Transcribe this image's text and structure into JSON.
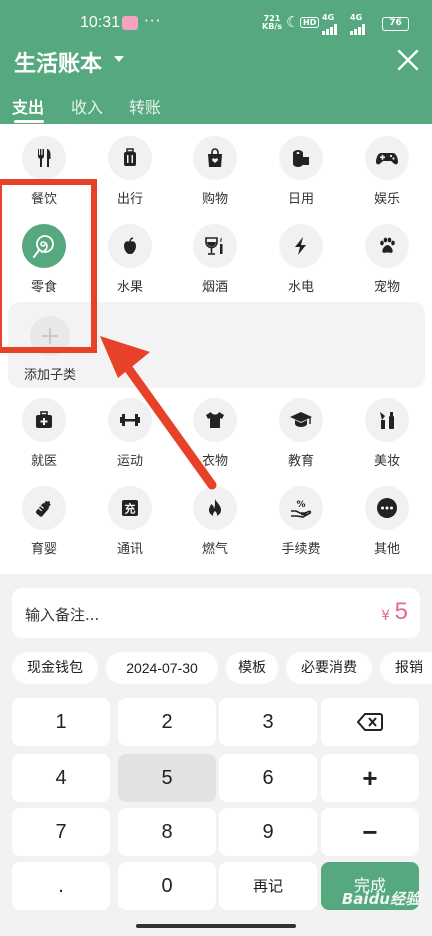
{
  "status_bar": {
    "time": "10:31",
    "dots": "···",
    "net_speed": "721\nKB/s",
    "hd": "HD",
    "sig1": "4G",
    "sig2": "4G",
    "battery": "76"
  },
  "header": {
    "title": "生活账本",
    "tabs": [
      {
        "label": "支出",
        "active": true
      },
      {
        "label": "收入",
        "active": false
      },
      {
        "label": "转账",
        "active": false
      }
    ],
    "bg_color": "#56a97f"
  },
  "categories": [
    {
      "label": "餐饮",
      "icon": "fork-knife-icon"
    },
    {
      "label": "出行",
      "icon": "suitcase-icon"
    },
    {
      "label": "购物",
      "icon": "shopping-bag-icon"
    },
    {
      "label": "日用",
      "icon": "toilet-roll-icon"
    },
    {
      "label": "娱乐",
      "icon": "gamepad-icon"
    },
    {
      "label": "零食",
      "icon": "lollipop-icon",
      "selected": true
    },
    {
      "label": "水果",
      "icon": "apple-icon"
    },
    {
      "label": "烟酒",
      "icon": "wine-glass-icon"
    },
    {
      "label": "水电",
      "icon": "lightning-icon"
    },
    {
      "label": "宠物",
      "icon": "paw-icon"
    },
    {
      "label": "就医",
      "icon": "medical-kit-icon"
    },
    {
      "label": "运动",
      "icon": "dumbbell-icon"
    },
    {
      "label": "衣物",
      "icon": "tshirt-icon"
    },
    {
      "label": "教育",
      "icon": "graduation-cap-icon"
    },
    {
      "label": "美妆",
      "icon": "cosmetics-icon"
    },
    {
      "label": "育婴",
      "icon": "baby-bottle-icon"
    },
    {
      "label": "通讯",
      "icon": "charge-icon"
    },
    {
      "label": "燃气",
      "icon": "flame-icon"
    },
    {
      "label": "手续费",
      "icon": "fee-hand-icon"
    },
    {
      "label": "其他",
      "icon": "more-icon"
    }
  ],
  "sub_panel": {
    "add_label": "添加子类"
  },
  "note": {
    "placeholder": "输入备注...",
    "currency": "¥",
    "amount": "5"
  },
  "chips": [
    {
      "label": "现金钱包"
    },
    {
      "label": "2024-07-30"
    },
    {
      "label": "模板"
    },
    {
      "label": "必要消费"
    },
    {
      "label": "报销"
    }
  ],
  "keypad": {
    "keys": [
      "1",
      "2",
      "3",
      "4",
      "5",
      "6",
      "7",
      "8",
      "9",
      ".",
      "0",
      "再记"
    ],
    "pressed_key": "5",
    "plus": "+",
    "minus": "−",
    "done": "完成"
  },
  "watermark": "Baidu经验",
  "colors": {
    "accent": "#56a97f",
    "amount": "#e46a88",
    "annotation": "#e8412a"
  }
}
